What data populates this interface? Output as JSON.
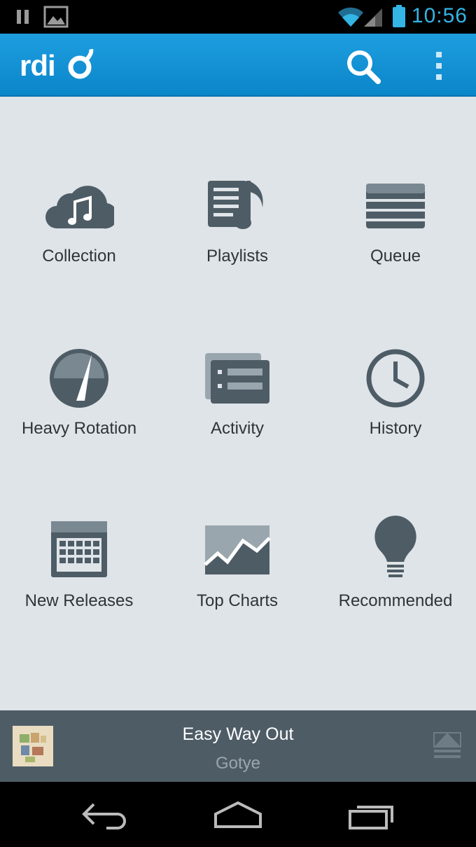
{
  "status_bar": {
    "time": "10:56",
    "icons": [
      "pause-icon",
      "image-icon",
      "wifi-icon",
      "signal-icon",
      "battery-icon"
    ],
    "accent_color": "#33b5e5"
  },
  "app_bar": {
    "logo_text": "rdio",
    "actions": [
      "search-icon",
      "overflow-menu-icon"
    ],
    "color": "#1a96d8"
  },
  "tiles": [
    {
      "label": "Collection",
      "icon": "cloud-music-icon"
    },
    {
      "label": "Playlists",
      "icon": "playlist-icon"
    },
    {
      "label": "Queue",
      "icon": "queue-icon"
    },
    {
      "label": "Heavy Rotation",
      "icon": "gauge-icon"
    },
    {
      "label": "Activity",
      "icon": "activity-icon"
    },
    {
      "label": "History",
      "icon": "clock-icon"
    },
    {
      "label": "New Releases",
      "icon": "calendar-icon"
    },
    {
      "label": "Top Charts",
      "icon": "chart-icon"
    },
    {
      "label": "Recommended",
      "icon": "lightbulb-icon"
    }
  ],
  "now_playing": {
    "title": "Easy Way Out",
    "artist": "Gotye",
    "album_art": "album-art",
    "action": "eject-icon"
  },
  "nav_bar": {
    "buttons": [
      "back-icon",
      "home-icon",
      "recent-apps-icon"
    ]
  }
}
